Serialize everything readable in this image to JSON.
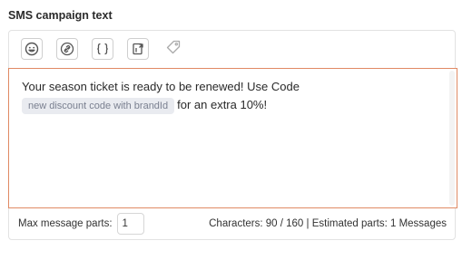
{
  "section": {
    "title": "SMS campaign text"
  },
  "toolbar": {
    "buttons": [
      {
        "icon": "emoji-icon"
      },
      {
        "icon": "link-icon"
      },
      {
        "icon": "curly-braces-icon"
      },
      {
        "icon": "export-icon"
      },
      {
        "icon": "tag-icon"
      }
    ]
  },
  "message": {
    "text_before": "Your season ticket is ready to be renewed! Use Code",
    "placeholder_chip": "new discount code with brandId",
    "text_after": "for an extra 10%!"
  },
  "footer": {
    "max_parts_label": "Max message parts:",
    "max_parts_value": "1",
    "stats": "Characters: 90 / 160 | Estimated parts: 1 Messages"
  },
  "colors": {
    "focus_border": "#e08a64",
    "chip_bg": "#e9ebf0"
  }
}
